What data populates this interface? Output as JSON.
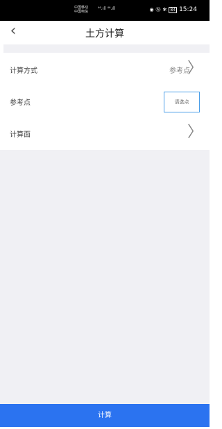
{
  "status_bar": {
    "carrier1": "中国移动",
    "carrier2": "中国电信",
    "signal": "⁴⁶.ıll ⁴⁶.ıll",
    "time": "15:24",
    "battery": "84"
  },
  "header": {
    "back_icon": "chevron-left-icon",
    "title": "土方计算"
  },
  "form": {
    "rows": [
      {
        "label": "计算方式",
        "value": "参考点"
      },
      {
        "label": "参考点",
        "button": "请选点"
      },
      {
        "label": "计算面"
      }
    ]
  },
  "footer": {
    "calc_label": "计算"
  },
  "colors": {
    "primary": "#2b73f0",
    "outline": "#4a9ee8",
    "background": "#f0f0f4"
  }
}
